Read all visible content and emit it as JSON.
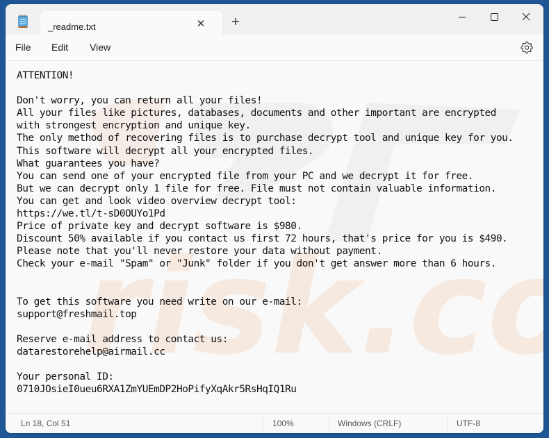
{
  "window": {
    "tab_title": "_readme.txt",
    "icons": {
      "app": "notepad-icon",
      "tab_close": "close-icon",
      "new_tab": "plus-icon",
      "minimize": "minimize-icon",
      "maximize": "maximize-icon",
      "close": "close-icon",
      "settings": "gear-icon"
    },
    "tab_close_glyph": "✕",
    "new_tab_glyph": "+"
  },
  "menu": {
    "file": "File",
    "edit": "Edit",
    "view": "View"
  },
  "document": {
    "lines": [
      "ATTENTION!",
      "",
      "Don't worry, you can return all your files!",
      "All your files like pictures, databases, documents and other important are encrypted",
      "with strongest encryption and unique key.",
      "The only method of recovering files is to purchase decrypt tool and unique key for you.",
      "This software will decrypt all your encrypted files.",
      "What guarantees you have?",
      "You can send one of your encrypted file from your PC and we decrypt it for free.",
      "But we can decrypt only 1 file for free. File must not contain valuable information.",
      "You can get and look video overview decrypt tool:",
      "https://we.tl/t-sD0OUYo1Pd",
      "Price of private key and decrypt software is $980.",
      "Discount 50% available if you contact us first 72 hours, that's price for you is $490.",
      "Please note that you'll never restore your data without payment.",
      "Check your e-mail \"Spam\" or \"Junk\" folder if you don't get answer more than 6 hours.",
      "",
      "",
      "To get this software you need write on our e-mail:",
      "support@freshmail.top",
      "",
      "Reserve e-mail address to contact us:",
      "datarestorehelp@airmail.cc",
      "",
      "Your personal ID:",
      "0710JOsieI0ueu6RXA1ZmYUEmDP2HoPifyXqAkr5RsHqIQ1Ru"
    ],
    "watermark_text": "risk.com"
  },
  "status": {
    "position": "Ln 18, Col 51",
    "zoom": "100%",
    "line_ending": "Windows (CRLF)",
    "encoding": "UTF-8"
  },
  "colors": {
    "desktop": "#1f5796",
    "watermark_orange": "#f0a060"
  }
}
